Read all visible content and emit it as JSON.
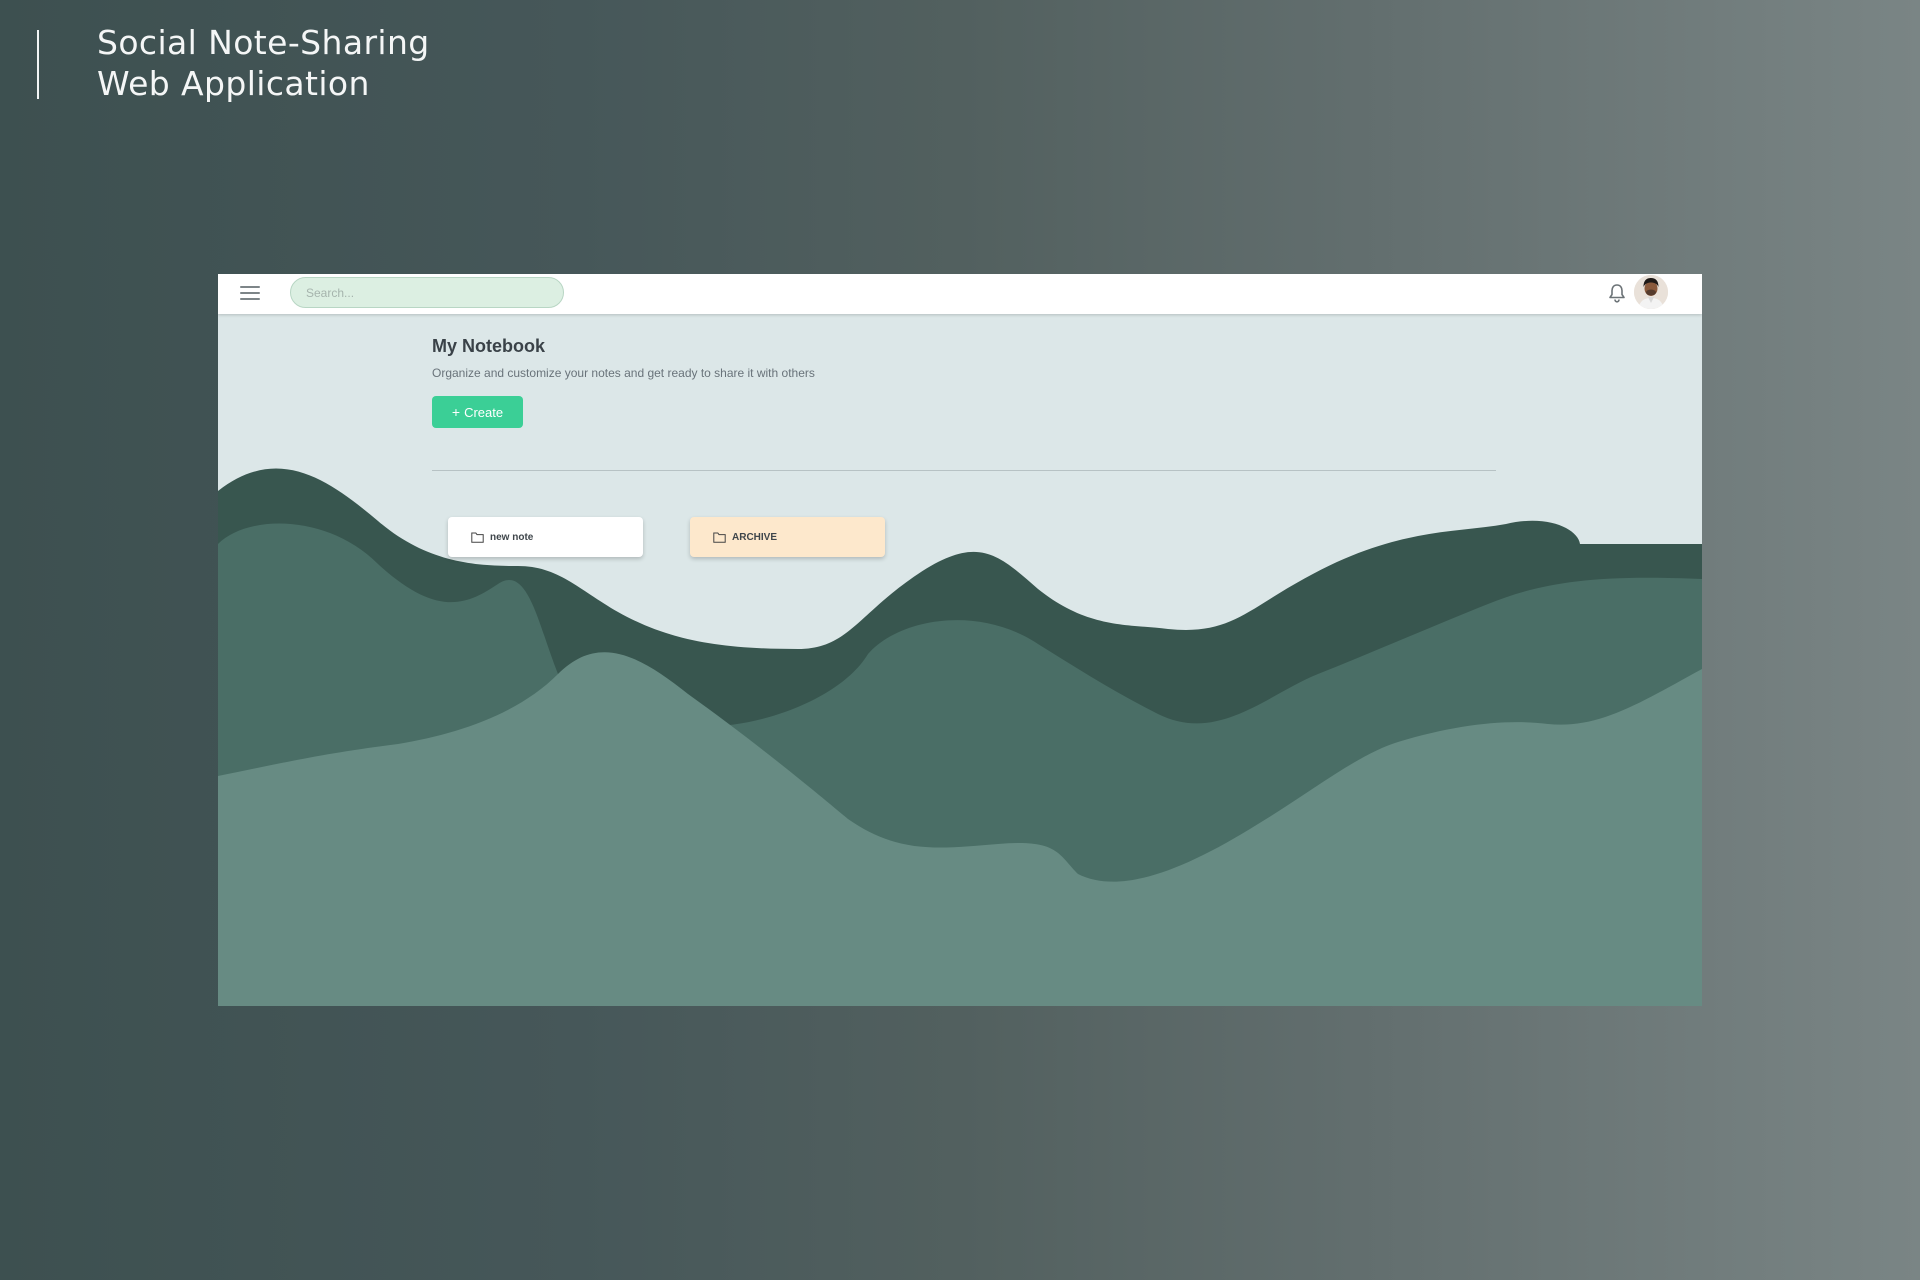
{
  "presentation": {
    "title_line1": "Social Note-Sharing",
    "title_line2": "Web Application"
  },
  "topbar": {
    "menu_icon": "hamburger-menu-icon",
    "search_placeholder": "Search...",
    "notification_icon": "bell-icon",
    "avatar_icon": "user-avatar"
  },
  "notebook": {
    "title": "My Notebook",
    "subtitle": "Organize and customize your notes and get ready to share it with others",
    "create_label": "Create",
    "create_icon": "plus-icon"
  },
  "folders": [
    {
      "label": "new note",
      "icon": "folder-icon",
      "color": "#ffffff"
    },
    {
      "label": "ARCHIVE",
      "icon": "folder-icon",
      "color": "#fde8cc"
    }
  ],
  "colors": {
    "accent": "#3bcf96",
    "background": "#dce7e8",
    "wave_dark": "#38564f",
    "wave_mid": "#4a6e66",
    "wave_light": "#678b83"
  }
}
